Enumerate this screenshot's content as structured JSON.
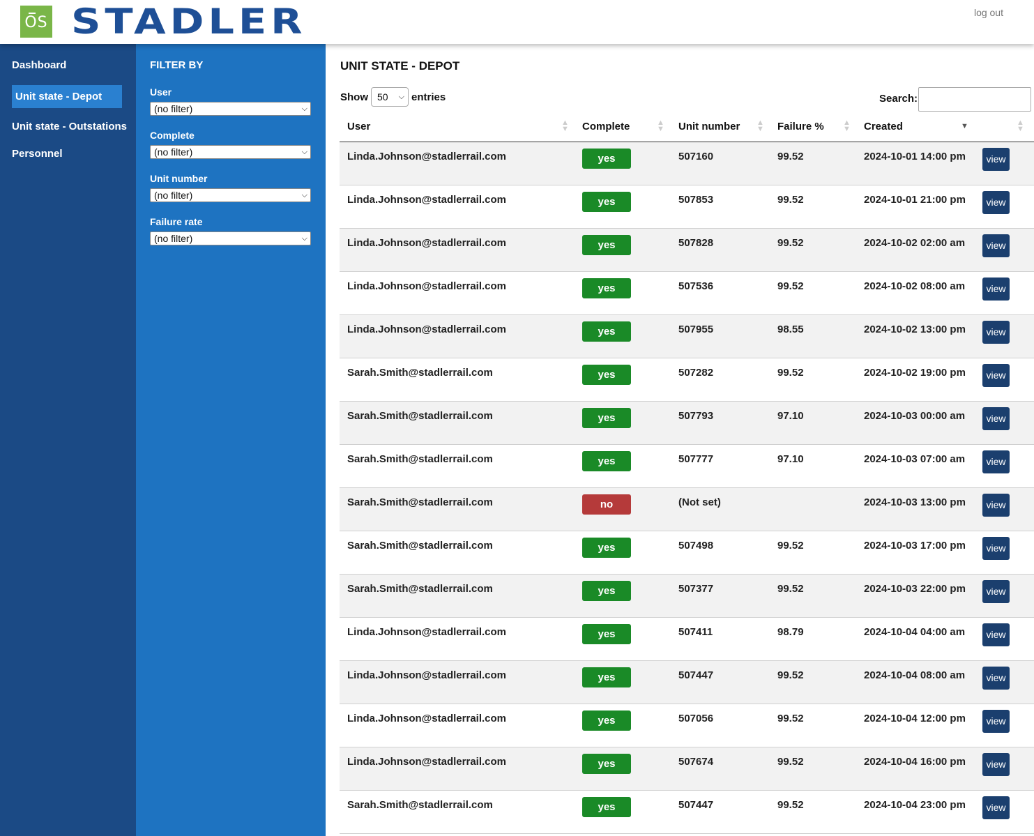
{
  "header": {
    "logo_text": "OS",
    "brand": "STADLER",
    "logout": "log out"
  },
  "nav": {
    "items": [
      {
        "label": "Dashboard",
        "active": false
      },
      {
        "label": "Unit state - Depot",
        "active": true
      },
      {
        "label": "Unit state - Outstations",
        "active": false
      },
      {
        "label": "Personnel",
        "active": false
      }
    ]
  },
  "filters": {
    "title": "FILTER BY",
    "fields": [
      {
        "label": "User",
        "value": "(no filter)"
      },
      {
        "label": "Complete",
        "value": "(no filter)"
      },
      {
        "label": "Unit number",
        "value": "(no filter)"
      },
      {
        "label": "Failure rate",
        "value": "(no filter)"
      }
    ]
  },
  "main": {
    "title": "UNIT STATE - DEPOT",
    "show_label": "Show",
    "entries_value": "50",
    "entries_label": "entries",
    "search_label": "Search:",
    "search_value": ""
  },
  "table": {
    "columns": [
      "User",
      "Complete",
      "Unit number",
      "Failure %",
      "Created",
      ""
    ],
    "sorted_column": "Created",
    "sort_direction": "desc",
    "view_label": "view",
    "rows": [
      {
        "user": "Linda.Johnson@stadlerrail.com",
        "complete": "yes",
        "unit": "507160",
        "failure": "99.52",
        "created": "2024-10-01 14:00 pm"
      },
      {
        "user": "Linda.Johnson@stadlerrail.com",
        "complete": "yes",
        "unit": "507853",
        "failure": "99.52",
        "created": "2024-10-01 21:00 pm"
      },
      {
        "user": "Linda.Johnson@stadlerrail.com",
        "complete": "yes",
        "unit": "507828",
        "failure": "99.52",
        "created": "2024-10-02 02:00 am"
      },
      {
        "user": "Linda.Johnson@stadlerrail.com",
        "complete": "yes",
        "unit": "507536",
        "failure": "99.52",
        "created": "2024-10-02 08:00 am"
      },
      {
        "user": "Linda.Johnson@stadlerrail.com",
        "complete": "yes",
        "unit": "507955",
        "failure": "98.55",
        "created": "2024-10-02 13:00 pm"
      },
      {
        "user": "Sarah.Smith@stadlerrail.com",
        "complete": "yes",
        "unit": "507282",
        "failure": "99.52",
        "created": "2024-10-02 19:00 pm"
      },
      {
        "user": "Sarah.Smith@stadlerrail.com",
        "complete": "yes",
        "unit": "507793",
        "failure": "97.10",
        "created": "2024-10-03 00:00 am"
      },
      {
        "user": "Sarah.Smith@stadlerrail.com",
        "complete": "yes",
        "unit": "507777",
        "failure": "97.10",
        "created": "2024-10-03 07:00 am"
      },
      {
        "user": "Sarah.Smith@stadlerrail.com",
        "complete": "no",
        "unit": "(Not set)",
        "failure": "",
        "created": "2024-10-03 13:00 pm"
      },
      {
        "user": "Sarah.Smith@stadlerrail.com",
        "complete": "yes",
        "unit": "507498",
        "failure": "99.52",
        "created": "2024-10-03 17:00 pm"
      },
      {
        "user": "Sarah.Smith@stadlerrail.com",
        "complete": "yes",
        "unit": "507377",
        "failure": "99.52",
        "created": "2024-10-03 22:00 pm"
      },
      {
        "user": "Linda.Johnson@stadlerrail.com",
        "complete": "yes",
        "unit": "507411",
        "failure": "98.79",
        "created": "2024-10-04 04:00 am"
      },
      {
        "user": "Linda.Johnson@stadlerrail.com",
        "complete": "yes",
        "unit": "507447",
        "failure": "99.52",
        "created": "2024-10-04 08:00 am"
      },
      {
        "user": "Linda.Johnson@stadlerrail.com",
        "complete": "yes",
        "unit": "507056",
        "failure": "99.52",
        "created": "2024-10-04 12:00 pm"
      },
      {
        "user": "Linda.Johnson@stadlerrail.com",
        "complete": "yes",
        "unit": "507674",
        "failure": "99.52",
        "created": "2024-10-04 16:00 pm"
      },
      {
        "user": "Sarah.Smith@stadlerrail.com",
        "complete": "yes",
        "unit": "507447",
        "failure": "99.52",
        "created": "2024-10-04 23:00 pm"
      }
    ]
  },
  "colors": {
    "nav_bg": "#1b4a85",
    "filter_bg": "#1e73c1",
    "active_nav": "#2a80d0",
    "brand": "#1e4f96",
    "logo_green": "#7ab648",
    "yes_badge": "#1a8a27",
    "no_badge": "#b53a3a",
    "view_button": "#1b3f6e"
  }
}
